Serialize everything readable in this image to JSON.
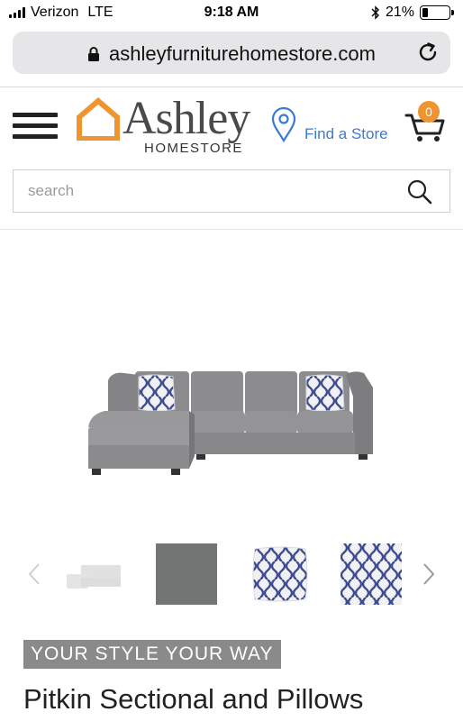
{
  "status_bar": {
    "carrier": "Verizon",
    "network": "LTE",
    "time": "9:18 AM",
    "battery": "21%",
    "battery_level": 0.21
  },
  "browser": {
    "url": "ashleyfurniturehomestore.com"
  },
  "header": {
    "logo_word": "Ashley",
    "logo_sub": "HOMESTORE",
    "find_store_label": "Find a Store",
    "cart_count": "0"
  },
  "search": {
    "placeholder": "search"
  },
  "product": {
    "tagline": "YOUR STYLE YOUR WAY",
    "title": "Pitkin Sectional and Pillows"
  },
  "colors": {
    "brand_orange": "#f0942f",
    "link_blue": "#3a7bd5",
    "sofa_gray": "#8e8e90"
  },
  "icons": {
    "menu": "hamburger-icon",
    "location": "map-pin-icon",
    "cart": "cart-icon",
    "search": "search-icon",
    "lock": "lock-icon",
    "reload": "reload-icon"
  }
}
